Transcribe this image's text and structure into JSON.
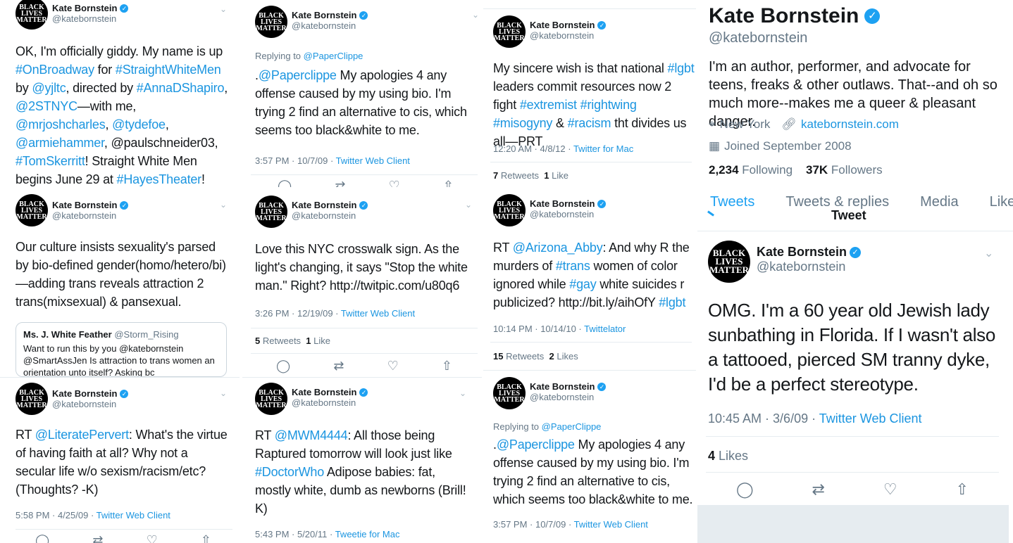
{
  "profile": {
    "name": "Kate Bornstein",
    "handle": "@katebornstein",
    "avatar_text": [
      "BLACK",
      "LIVES",
      "MATTER"
    ],
    "bio": "I'm an author, performer, and advocate for teens, freaks & other outlaws. That--and oh so much more--makes me a queer & pleasant danger.",
    "location": "New York",
    "website": "katebornstein.com",
    "joined": "Joined September 2008",
    "following_count": "2,234",
    "following_label": "Following",
    "followers_count": "37K",
    "followers_label": "Followers",
    "tabs": [
      "Tweets",
      "Tweets & replies",
      "Media",
      "Like"
    ],
    "partial_header": "Tweet"
  },
  "colors": {
    "link": "#1b95e0",
    "verified": "#1da1f2",
    "muted": "#657786"
  },
  "tweets": {
    "c1t1": {
      "text_parts": [
        "OK, I'm officially giddy. My name is up ",
        "#OnBroadway",
        " for ",
        "#StraightWhiteMen",
        " by ",
        "@yjltc",
        ", directed by ",
        "#AnnaDShapiro",
        ", ",
        "@2STNYC",
        "—with me,  ",
        "@mrjoshcharles",
        ", ",
        "@tydefoe",
        ", ",
        "@armiehammer",
        ", @paulschneider03, ",
        "#TomSkerritt",
        "! Straight White Men begins June 29 at ",
        "#HayesTheater",
        "!"
      ]
    },
    "c1t2": {
      "text": "Our culture insists sexuality's parsed by bio-defined gender(homo/hetero/bi)—adding trans reveals attraction 2 trans(mixsexual) & pansexual.",
      "quote_name": "Ms. J. White Feather",
      "quote_handle": "@Storm_Rising",
      "quote_text": "Want to run this by you @katebornstein @SmartAssJen Is attraction to trans women an orientation unto itself? Asking bc"
    },
    "c1t3": {
      "text_parts": [
        "RT ",
        "@LiteratePervert",
        ": What's the virtue of having faith at all? Why not a secular life w/o sexism/racism/etc? (Thoughts? -K)"
      ],
      "time": "5:58 PM · 4/25/09 · ",
      "source": "Twitter Web Client"
    },
    "c2t1": {
      "reply_label": "Replying to ",
      "reply_to": "@PaperClippe",
      "text_parts": [
        ".",
        "@Paperclippe",
        " My apologies 4 any offense caused by my using bio. I'm trying 2 find an alternative to cis, which seems too black&white to me."
      ],
      "time": "3:57 PM · 10/7/09 · ",
      "source": "Twitter Web Client"
    },
    "c2t2": {
      "text": "Love this NYC crosswalk sign. As the light's changing, it says \"Stop the white man.\" Right?  http://twitpic.com/u80q6",
      "time": "3:26 PM · 12/19/09 · ",
      "source": "Twitter Web Client",
      "retweets": "5",
      "retweets_label": "Retweets",
      "likes": "1",
      "likes_label": "Like"
    },
    "c2t3": {
      "text_parts": [
        "RT ",
        "@MWM4444",
        ": All those being Raptured tomorrow will look just like ",
        "#DoctorWho",
        " Adipose babies: fat, mostly white, dumb as newborns (Brill! K)"
      ],
      "time": "5:43 PM · 5/20/11 · ",
      "source": "Tweetie for Mac"
    },
    "c3t1": {
      "text_parts": [
        "My sincere wish is that national ",
        "#lgbt",
        " leaders commit resources now 2 fight ",
        "#extremist",
        " ",
        "#rightwing",
        " ",
        "#misogyny",
        " & ",
        "#racism",
        " tht divides us all—PRT"
      ],
      "time": "12:20 AM · 4/8/12 · ",
      "source": "Twitter for Mac",
      "retweets": "7",
      "retweets_label": "Retweets",
      "likes": "1",
      "likes_label": "Like"
    },
    "c3t2": {
      "text_parts": [
        "RT ",
        "@Arizona_Abby",
        ":  And why R the murders of ",
        "#trans",
        " women of color ignored while ",
        "#gay",
        " white suicides r publicized? http://bit.ly/aihOfY ",
        "#lgbt"
      ],
      "time": "10:14 PM · 10/14/10 · ",
      "source": "Twittelator",
      "retweets": "15",
      "retweets_label": "Retweets",
      "likes": "2",
      "likes_label": "Likes"
    },
    "c3t3": {
      "reply_label": "Replying to ",
      "reply_to": "@PaperClippe",
      "text_parts": [
        ".",
        "@Paperclippe",
        " My apologies 4 any offense caused by my using bio. I'm trying 2 find an alternative to cis, which seems too black&white to me."
      ],
      "time": "3:57 PM · 10/7/09 · ",
      "source": "Twitter Web Client"
    },
    "c4t1": {
      "text": "OMG. I'm a 60 year old Jewish lady sunbathing in Florida. If I wasn't also a tattooed, pierced SM tranny dyke, I'd be a perfect stereotype.",
      "time": "10:45 AM · 3/6/09 · ",
      "source": "Twitter Web Client",
      "likes": "4",
      "likes_label": "Likes"
    }
  }
}
